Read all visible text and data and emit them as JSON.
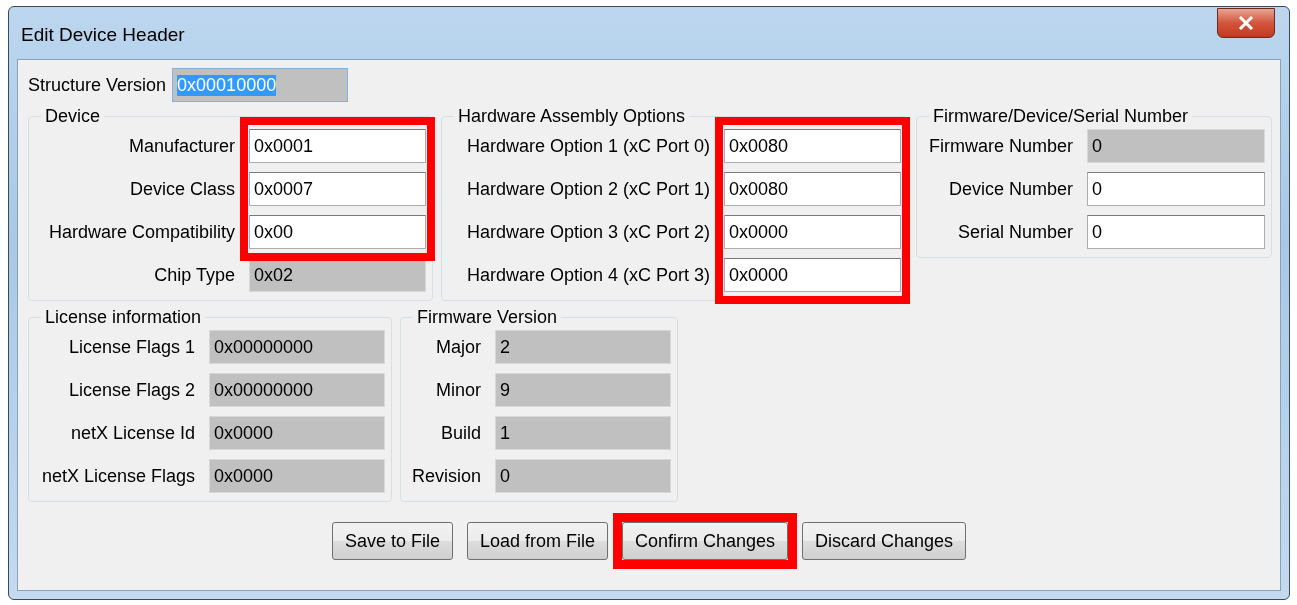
{
  "window": {
    "title": "Edit Device Header"
  },
  "structure_version": {
    "label": "Structure Version",
    "value": "0x00010000",
    "editable": false,
    "text_selected": true
  },
  "top_groups": [
    {
      "title": "Device",
      "fields": [
        {
          "label": "Manufacturer",
          "value": "0x0001",
          "editable": true,
          "highlighted": true
        },
        {
          "label": "Device Class",
          "value": "0x0007",
          "editable": true,
          "highlighted": true
        },
        {
          "label": "Hardware Compatibility",
          "value": "0x00",
          "editable": true,
          "highlighted": true
        },
        {
          "label": "Chip Type",
          "value": "0x02",
          "editable": false,
          "highlighted": false
        }
      ]
    },
    {
      "title": "Hardware Assembly Options",
      "fields": [
        {
          "label": "Hardware Option 1 (xC Port 0)",
          "value": "0x0080",
          "editable": true,
          "highlighted": true
        },
        {
          "label": "Hardware Option 2 (xC Port 1)",
          "value": "0x0080",
          "editable": true,
          "highlighted": true
        },
        {
          "label": "Hardware Option 3 (xC Port 2)",
          "value": "0x0000",
          "editable": true,
          "highlighted": true
        },
        {
          "label": "Hardware Option 4 (xC Port 3)",
          "value": "0x0000",
          "editable": true,
          "highlighted": true
        }
      ]
    },
    {
      "title": "Firmware/Device/Serial Number",
      "fields": [
        {
          "label": "Firmware Number",
          "value": "0",
          "editable": false,
          "highlighted": false
        },
        {
          "label": "Device Number",
          "value": "0",
          "editable": true,
          "highlighted": false
        },
        {
          "label": "Serial Number",
          "value": "0",
          "editable": true,
          "highlighted": false
        }
      ]
    }
  ],
  "bottom_groups": [
    {
      "title": "License information",
      "fields": [
        {
          "label": "License Flags 1",
          "value": "0x00000000",
          "editable": false,
          "highlighted": false
        },
        {
          "label": "License Flags 2",
          "value": "0x00000000",
          "editable": false,
          "highlighted": false
        },
        {
          "label": "netX License Id",
          "value": "0x0000",
          "editable": false,
          "highlighted": false
        },
        {
          "label": "netX License Flags",
          "value": "0x0000",
          "editable": false,
          "highlighted": false
        }
      ]
    },
    {
      "title": "Firmware Version",
      "fields": [
        {
          "label": "Major",
          "value": "2",
          "editable": false,
          "highlighted": false
        },
        {
          "label": "Minor",
          "value": "9",
          "editable": false,
          "highlighted": false
        },
        {
          "label": "Build",
          "value": "1",
          "editable": false,
          "highlighted": false
        },
        {
          "label": "Revision",
          "value": "0",
          "editable": false,
          "highlighted": false
        }
      ]
    }
  ],
  "buttons": [
    {
      "label": "Save to File",
      "highlighted": false
    },
    {
      "label": "Load from File",
      "highlighted": false
    },
    {
      "label": "Confirm Changes",
      "highlighted": true
    },
    {
      "label": "Discard Changes",
      "highlighted": false
    }
  ]
}
